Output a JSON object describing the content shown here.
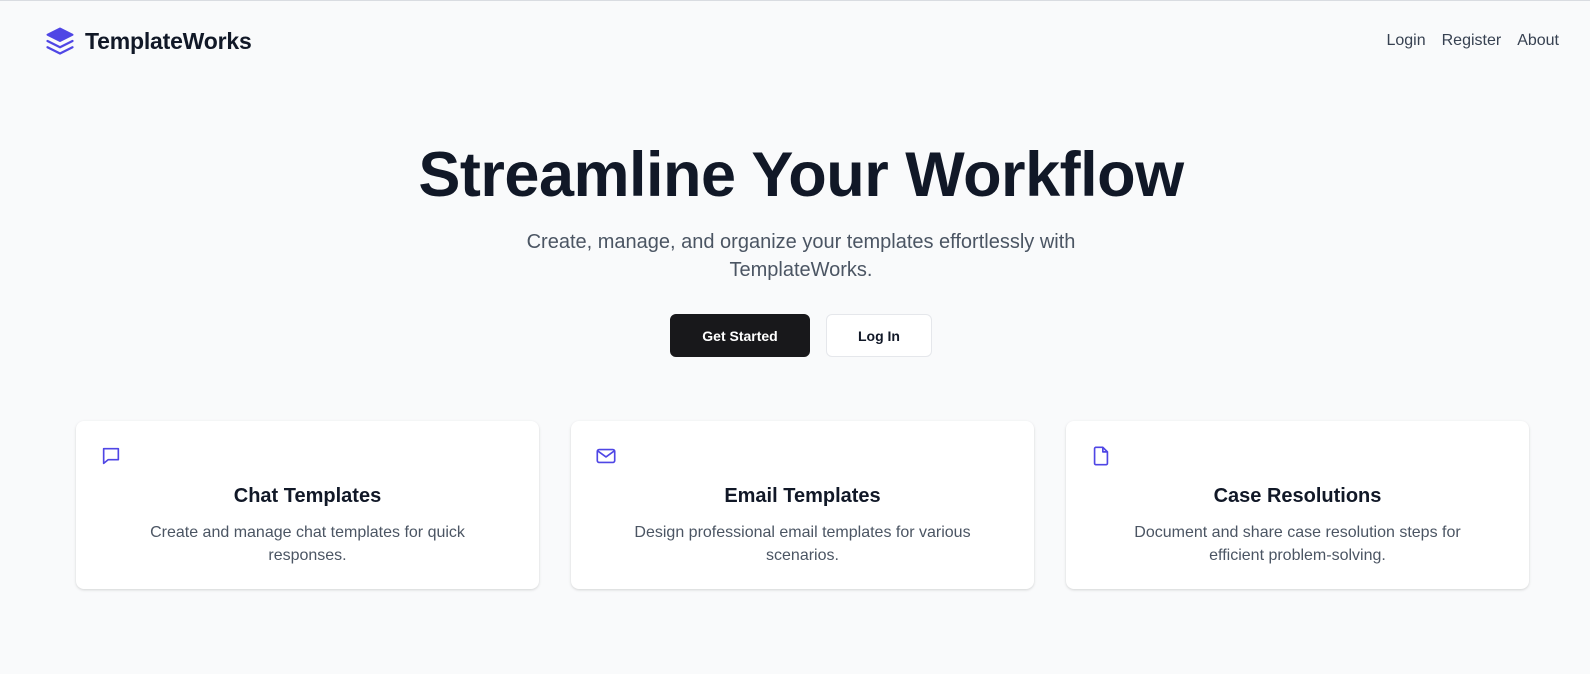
{
  "app": {
    "name": "TemplateWorks",
    "accent_color": "#4f46e5",
    "logo_icon": "layers-icon"
  },
  "nav": {
    "items": [
      {
        "label": "Login"
      },
      {
        "label": "Register"
      },
      {
        "label": "About"
      }
    ]
  },
  "hero": {
    "title": "Streamline Your Workflow",
    "subtitle": "Create, manage, and organize your templates effortlessly with TemplateWorks.",
    "primary_button": "Get Started",
    "secondary_button": "Log In"
  },
  "features": [
    {
      "icon": "chat-bubble-icon",
      "title": "Chat Templates",
      "description": "Create and manage chat templates for quick responses."
    },
    {
      "icon": "mail-icon",
      "title": "Email Templates",
      "description": "Design professional email templates for various scenarios."
    },
    {
      "icon": "file-icon",
      "title": "Case Resolutions",
      "description": "Document and share case resolution steps for efficient problem-solving."
    }
  ]
}
